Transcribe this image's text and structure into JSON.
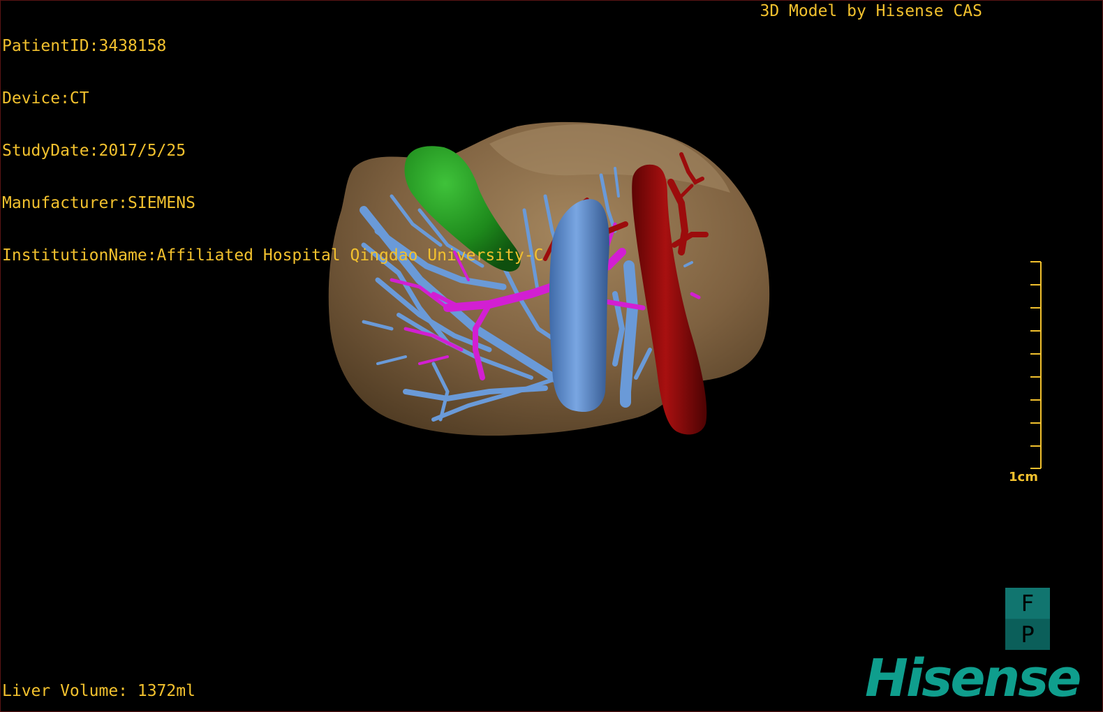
{
  "dicom_info": {
    "patient_id": "PatientID:3438158",
    "device": "Device:CT",
    "study_date": "StudyDate:2017/5/25",
    "manufacturer": "Manufacturer:SIEMENS",
    "institution": "InstitutionName:Affiliated Hospital Qingdao University-C"
  },
  "credit": "3D Model by Hisense CAS",
  "liver_volume": "Liver Volume: 1372ml",
  "scale_bar": {
    "label": "1cm",
    "tick_count": 10
  },
  "orientation_cube": {
    "top_face": "F",
    "bottom_face": "P",
    "color": "#0f6b66"
  },
  "logo": "Hisense",
  "colors": {
    "overlay_text": "#f2c12e",
    "liver": "#7b5e3a",
    "portal_vein": "#6a9ad8",
    "hepatic_artery": "#9c0c0c",
    "gallbladder": "#1f9a1f",
    "bile_duct": "#d21fd2",
    "logo": "#0f9e8d"
  },
  "model_structures": [
    "liver",
    "gallbladder",
    "portal-vein",
    "inferior-vena-cava",
    "aorta",
    "hepatic-artery",
    "bile-duct"
  ]
}
